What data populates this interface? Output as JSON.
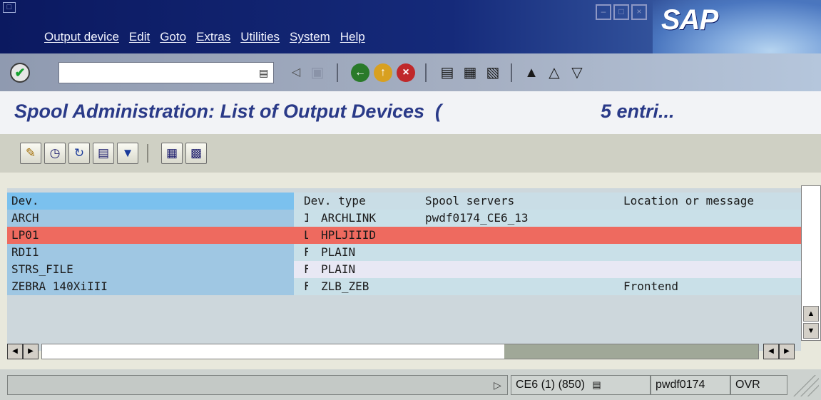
{
  "menu": {
    "items": [
      "Output device",
      "Edit",
      "Goto",
      "Extras",
      "Utilities",
      "System",
      "Help"
    ]
  },
  "brand": {
    "logo_text": "SAP"
  },
  "toolbar": {
    "command_value": "",
    "icons": [
      "enter-icon",
      "help-icon",
      "back-arrow-icon",
      "save-icon",
      "back-icon",
      "exit-icon",
      "cancel-icon",
      "print-icon",
      "find-icon",
      "find-next-icon",
      "first-page-icon",
      "previous-page-icon",
      "next-page-icon"
    ]
  },
  "title": {
    "text": "Spool Administration: List of Output Devices  (",
    "count": "5 entri..."
  },
  "app_toolbar": {
    "icons": [
      "edit-pencil-icon",
      "history-icon",
      "refresh-icon",
      "print-list-icon",
      "filter-icon",
      "details-icon",
      "printer-settings-icon"
    ]
  },
  "list": {
    "headers": {
      "dev": "Dev.",
      "type": "Dev. type",
      "servers": "Spool servers",
      "location": "Location or message"
    },
    "rows": [
      {
        "dev": "ARCH",
        "class": "I",
        "type": "ARCHLINK",
        "servers": "pwdf0174_CE6_13",
        "location": ""
      },
      {
        "dev": "LP01",
        "class": "L",
        "type": "HPLJIIID",
        "servers": "",
        "location": ""
      },
      {
        "dev": "RDI1",
        "class": "F",
        "type": "PLAIN",
        "servers": "",
        "location": ""
      },
      {
        "dev": "STRS_FILE",
        "class": "F",
        "type": "PLAIN",
        "servers": "",
        "location": ""
      },
      {
        "dev": "ZEBRA 140XiIII",
        "class": "F",
        "type": "ZLB_ZEB",
        "servers": "",
        "location": "Frontend"
      }
    ]
  },
  "status": {
    "system": "CE6 (1) (850)",
    "server": "pwdf0174",
    "mode": "OVR"
  },
  "colors": {
    "selected_row": "#ee6a5f",
    "title_text": "#2a3a88"
  }
}
